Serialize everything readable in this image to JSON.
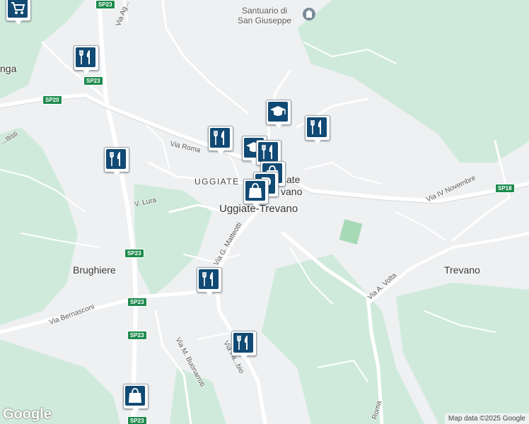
{
  "map": {
    "labels": {
      "uggiate_trevano": "Uggiate-Trevano",
      "uggiate": "UGGIATE",
      "trevano": "Trevano",
      "brughiere": "Brughiere",
      "partial_left": "nga",
      "santuario_line1": "Santuario di",
      "santuario_line2": "San Giuseppe",
      "partial_ate": "ate",
      "partial_vano": "vano"
    },
    "streets": {
      "via_roma_top": "Via Roma",
      "via_lura": "V. Lura",
      "via_matteotti": "Via G. Matteotti",
      "via_iv_novembre": "Via IV Novembre",
      "via_volta": "Via A. Volta",
      "via_bernasconi": "Via Bernasconi",
      "via_buonarroti": "Via M. Buonarroti",
      "via_fabbio": "Via Fa...bio",
      "via_roma_bottom": "Roma",
      "via_battisti": "...ttisti",
      "via_ag": "Via Ag..."
    },
    "road_shields": {
      "sp23_top": "SP23",
      "sp23_a": "SP23",
      "sp20": "SP20",
      "sp23_b": "SP23",
      "sp23_c": "SP23",
      "sp23_d": "SP23",
      "sp23_e": "SP23",
      "sp18": "SP18"
    },
    "markers": [
      {
        "type": "shopping-cart",
        "name": "supermarket-marker"
      },
      {
        "type": "restaurant",
        "name": "restaurant-marker"
      },
      {
        "type": "restaurant",
        "name": "restaurant-marker"
      },
      {
        "type": "restaurant",
        "name": "restaurant-marker"
      },
      {
        "type": "school",
        "name": "school-marker"
      },
      {
        "type": "restaurant",
        "name": "restaurant-marker"
      },
      {
        "type": "school",
        "name": "school-marker"
      },
      {
        "type": "restaurant",
        "name": "restaurant-marker"
      },
      {
        "type": "shopping-bag",
        "name": "shop-marker"
      },
      {
        "type": "parking",
        "name": "parking-marker"
      },
      {
        "type": "shopping-bag",
        "name": "shop-marker"
      },
      {
        "type": "restaurant",
        "name": "restaurant-marker"
      },
      {
        "type": "restaurant",
        "name": "restaurant-marker"
      },
      {
        "type": "shopping-bag",
        "name": "shop-marker"
      }
    ],
    "google_logo": "Google",
    "attribution": "Map data ©2025 Google",
    "colors": {
      "background": "#eef0f2",
      "green_area": "#cfeadb",
      "road": "#ffffff",
      "marker_fill": "#114a74",
      "shield": "#1c8a4c"
    }
  }
}
